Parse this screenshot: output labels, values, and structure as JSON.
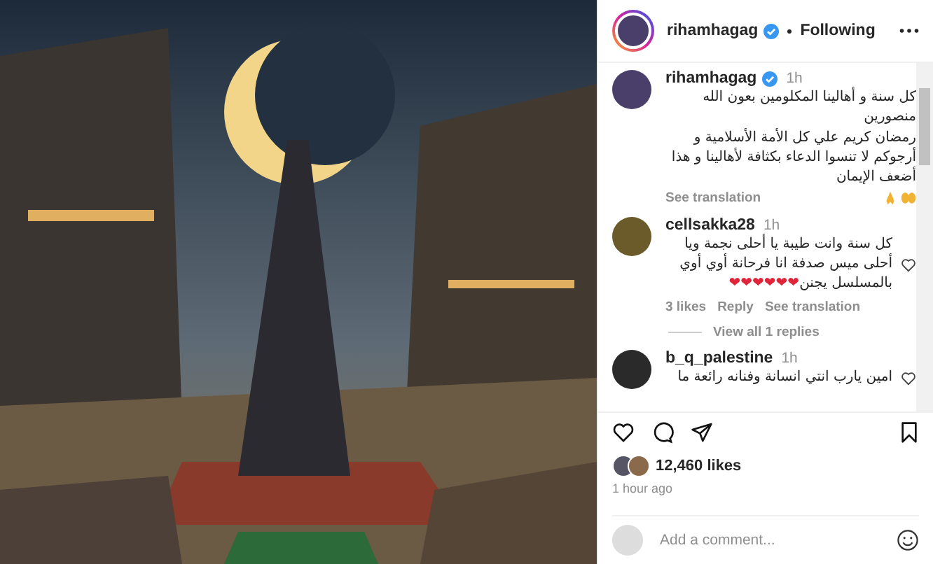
{
  "header": {
    "username": "rihamhagag",
    "verified": true,
    "status": "Following"
  },
  "caption": {
    "username": "rihamhagag",
    "verified": true,
    "time": "1h",
    "paragraphs": [
      "كل سنة و أهالينا المكلومين بعون الله منصورين",
      "رمضان كريم علي كل الأمة الأسلامية و أرجوكم لا تنسوا الدعاء بكثافة لأهالينا و هذا أضعف الإيمان"
    ],
    "translate": "See translation"
  },
  "comments": [
    {
      "username": "cellsakka28",
      "time": "1h",
      "text": "كل سنة وانت طيبة يا أحلى نجمة ويا أحلى ميس صدفة انا فرحانة أوي أوي بالمسلسل يجنن",
      "emoji": "❤❤❤❤❤❤",
      "likes": "3 likes",
      "reply": "Reply",
      "translate": "See translation",
      "replies": "View all 1 replies",
      "liked": false
    },
    {
      "username": "b_q_palestine",
      "time": "1h",
      "text": "امين يارب انتي انسانة وفنانه رائعة ما",
      "liked": false
    }
  ],
  "likes": "12,460 likes",
  "time_ago": "1 hour ago",
  "saved": false,
  "comment_field": {
    "placeholder": "Add a comment..."
  }
}
